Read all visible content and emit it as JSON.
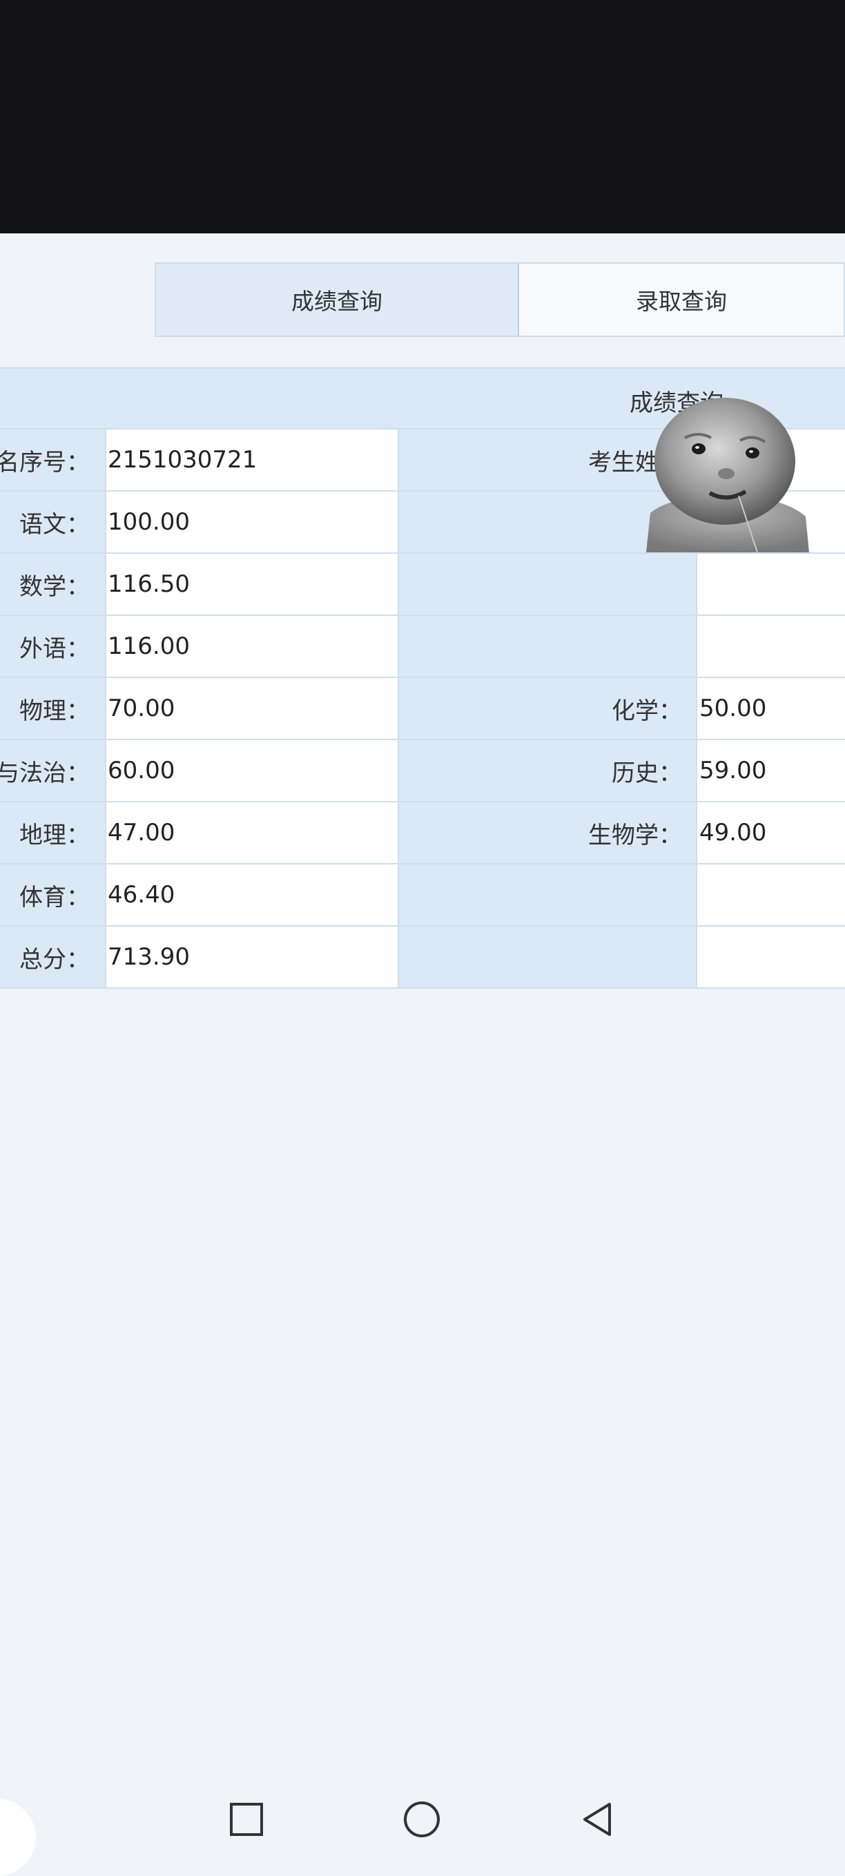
{
  "tabs": [
    {
      "label": "成绩查询",
      "active": true
    },
    {
      "label": "录取查询",
      "active": false
    }
  ],
  "table_title": "成绩查询",
  "rows": [
    {
      "l1": "报名序号：",
      "v1": "2151030721",
      "l2": "考生姓名",
      "v2": ""
    },
    {
      "l1": "语文：",
      "v1": "100.00",
      "l2": "",
      "v2": ""
    },
    {
      "l1": "数学：",
      "v1": "116.50",
      "l2": "",
      "v2": ""
    },
    {
      "l1": "外语：",
      "v1": "116.00",
      "l2": "",
      "v2": ""
    },
    {
      "l1": "物理：",
      "v1": "70.00",
      "l2": "化学：",
      "v2": "50.00"
    },
    {
      "l1": "道德与法治：",
      "v1": "60.00",
      "l2": "历史：",
      "v2": "59.00"
    },
    {
      "l1": "地理：",
      "v1": "47.00",
      "l2": "生物学：",
      "v2": "49.00"
    },
    {
      "l1": "体育：",
      "v1": "46.40",
      "l2": "",
      "v2": ""
    },
    {
      "l1": "总分：",
      "v1": "713.90",
      "l2": "",
      "v2": ""
    }
  ],
  "nav": {
    "icons": [
      "recents-square-icon",
      "home-circle-icon",
      "back-triangle-icon"
    ]
  },
  "colors": {
    "header_bg": "#121214",
    "page_bg": "#f0f3f7",
    "label_bg": "#dbe8f5",
    "value_bg": "#ffffff",
    "border": "#cfdeeb"
  }
}
